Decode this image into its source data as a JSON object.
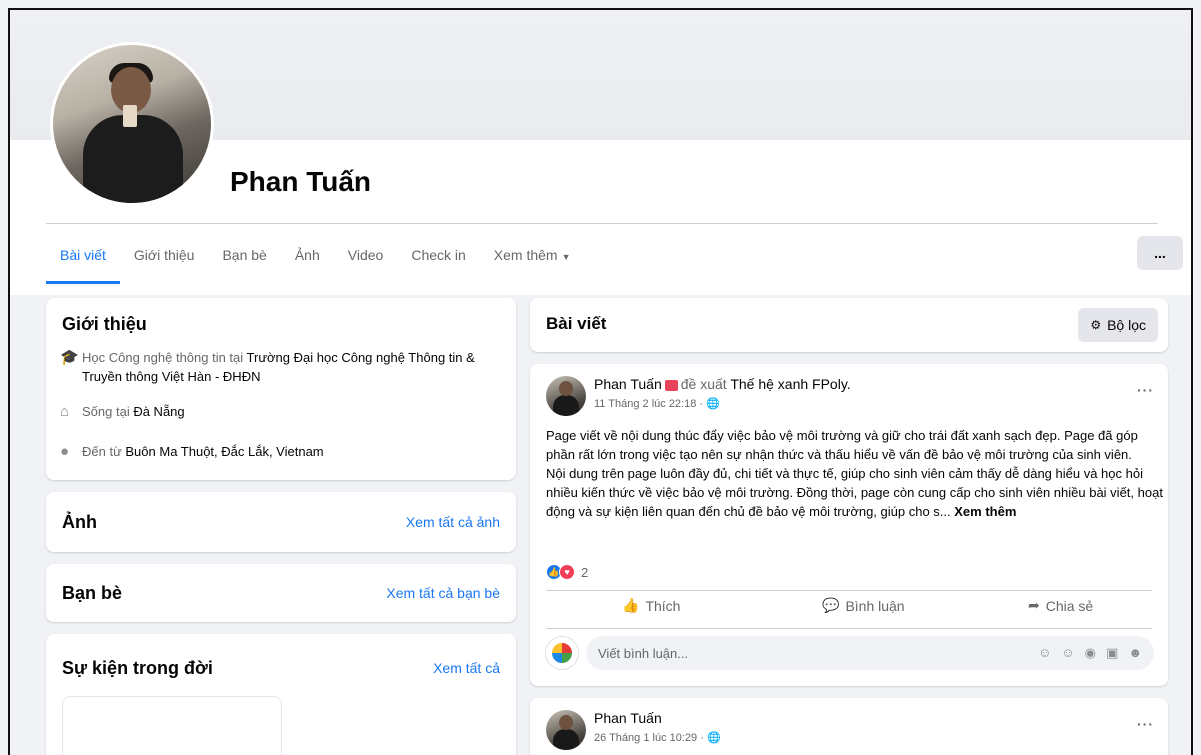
{
  "profile": {
    "name": "Phan Tuấn"
  },
  "tabs": [
    {
      "label": "Bài viết",
      "active": true
    },
    {
      "label": "Giới thiệu"
    },
    {
      "label": "Bạn bè"
    },
    {
      "label": "Ảnh"
    },
    {
      "label": "Video"
    },
    {
      "label": "Check in"
    },
    {
      "label": "Xem thêm"
    }
  ],
  "more_button": "...",
  "intro": {
    "title": "Giới thiệu",
    "items": [
      {
        "icon": "graduation-cap-icon",
        "prefix": "Học Công nghệ thông tin tại ",
        "bold": "Trường Đại học Công nghệ Thông tin & Truyền thông Việt Hàn - ĐHĐN"
      },
      {
        "icon": "home-icon",
        "prefix": "Sống tại ",
        "bold": "Đà Nẵng"
      },
      {
        "icon": "location-pin-icon",
        "prefix": "Đến từ ",
        "bold": "Buôn Ma Thuột, Đắc Lắk, Vietnam"
      }
    ]
  },
  "photos": {
    "title": "Ảnh",
    "link": "Xem tất cả ảnh"
  },
  "friends": {
    "title": "Bạn bè",
    "link": "Xem tất cả bạn bè"
  },
  "life_events": {
    "title": "Sự kiện trong đời",
    "link": "Xem tất cả"
  },
  "posts_header": {
    "title": "Bài viết",
    "filter": "Bộ lọc"
  },
  "post1": {
    "author": "Phan Tuấn",
    "verb": "đề xuất",
    "target": "Thế hệ xanh FPoly.",
    "time": "11 Tháng 2 lúc 22:18 · ",
    "paragraph1": "Page viết về nội dung thúc đẩy việc bảo vệ môi trường và giữ cho trái đất xanh sạch đẹp. Page đã góp phần rất lớn trong việc tạo nên sự nhận thức và thấu hiểu về vấn đề bảo vệ môi trường của sinh viên.",
    "paragraph2": "Nội dung trên page luôn đầy đủ, chi tiết và thực tế, giúp cho sinh viên cảm thấy dễ dàng hiểu và học hỏi nhiều kiến thức về việc bảo vệ môi trường. Đồng thời, page còn cung cấp cho sinh viên nhiều bài viết, hoạt động và sự kiện liên quan đến chủ đề bảo vệ môi trường, giúp cho s...",
    "see_more": "Xem thêm",
    "reaction_count": "2",
    "like": "Thích",
    "comment": "Bình luận",
    "share": "Chia sẻ",
    "comment_placeholder": "Viết bình luận..."
  },
  "post2": {
    "author": "Phan Tuấn",
    "time": "26 Tháng 1 lúc 10:29 · "
  }
}
